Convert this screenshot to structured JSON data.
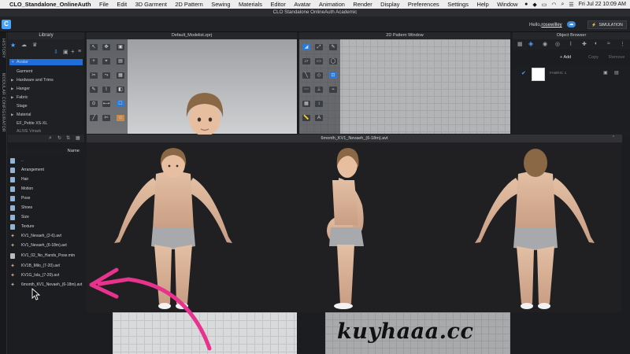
{
  "menubar": {
    "app_name": "CLO_Standalone_OnlineAuth",
    "items": [
      "File",
      "Edit",
      "3D Garment",
      "2D Pattern",
      "Sewing",
      "Materials",
      "Editor",
      "Avatar",
      "Animation",
      "Render",
      "Display",
      "Preferences",
      "Settings",
      "Help",
      "Window"
    ],
    "clock": "Fri Jul 22  10:09 AM"
  },
  "window_title": "CLO Standalone OnlineAuth Academic",
  "header": {
    "hello_prefix": "Hello,",
    "username": "rosewilley",
    "simulation_label": "SIMULATION"
  },
  "left_strip": {
    "history_label": "HISTORY",
    "modular_label": "MODULAR CONFIGURATOR"
  },
  "library": {
    "title": "Library",
    "tree": [
      "Avatar",
      "Garment",
      "Hardware and Trims",
      "Hanger",
      "Fabric",
      "Stage",
      "Material",
      "EF_Petite XS-XL",
      "ALIVE Vmark"
    ],
    "name_header": "Name",
    "files": [
      {
        "name": "..",
        "icon": "folder-icon"
      },
      {
        "name": "Arrangement",
        "icon": "folder-icon"
      },
      {
        "name": "Hair",
        "icon": "folder-icon"
      },
      {
        "name": "Motion",
        "icon": "folder-icon"
      },
      {
        "name": "Pose",
        "icon": "folder-icon"
      },
      {
        "name": "Shoes",
        "icon": "folder-icon"
      },
      {
        "name": "Size",
        "icon": "folder-icon"
      },
      {
        "name": "Texture",
        "icon": "folder-icon"
      },
      {
        "name": "KV1_Nevaeh_(2-6).avt",
        "icon": "avatar-icon"
      },
      {
        "name": "KV1_Nevaeh_(6-18m).avt",
        "icon": "avatar-icon"
      },
      {
        "name": "KV1_02_No_Hands_Pose.mtn",
        "icon": "motion-file-icon"
      },
      {
        "name": "KV1B_Milo_(7-20).avt",
        "icon": "avatar-icon"
      },
      {
        "name": "KV1G_Isla_(7-20).avt",
        "icon": "avatar-icon"
      },
      {
        "name": "6month_KV1_Nevaeh_(6-18m).avt",
        "icon": "avatar-icon"
      }
    ]
  },
  "viewports": {
    "view3d_title": "Default_Modelist.zprj",
    "view2d_title": "2D Pattern Window"
  },
  "object_browser": {
    "title": "Object Browser",
    "add_label": "Add",
    "copy_label": "Copy",
    "remove_label": "Remove",
    "fabric_name": "FABRIC 1"
  },
  "popup": {
    "title": "6month_KV1_Nevaeh_(6-18m).avt"
  },
  "watermark": "kuyhaaa.cc",
  "colors": {
    "accent": "#1e6fd9",
    "arrow": "#e8338c",
    "panel": "#1b1d21"
  }
}
